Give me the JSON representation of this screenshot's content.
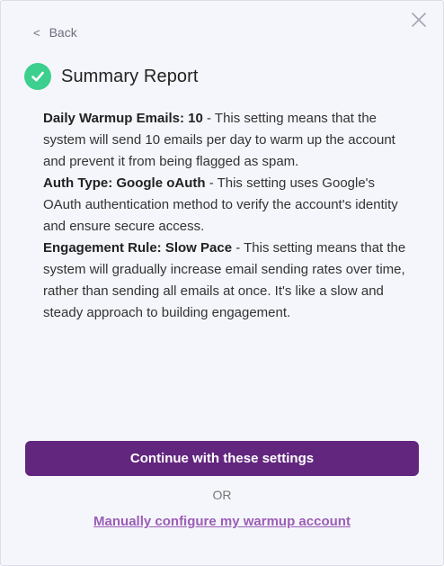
{
  "nav": {
    "back_label": "Back",
    "back_chevron": "<",
    "close_icon": "close-icon"
  },
  "header": {
    "title": "Summary Report",
    "status_icon": "check-circle-icon",
    "status_color": "#3ccf8e"
  },
  "summary": {
    "items": [
      {
        "label": "Daily Warmup Emails: 10",
        "description": " - This setting means that the system will send 10 emails per day to warm up the account and prevent it from being flagged as spam."
      },
      {
        "label": "Auth Type: Google oAuth",
        "description": " - This setting uses Google's OAuth authentication method to verify the account's identity and ensure secure access."
      },
      {
        "label": "Engagement Rule: Slow Pace",
        "description": " - This setting means that the system will gradually increase email sending rates over time, rather than sending all emails at once. It's like a slow and steady approach to building engagement."
      }
    ]
  },
  "actions": {
    "continue_label": "Continue with these settings",
    "continue_color": "#62267e",
    "or_label": "OR",
    "manual_label": "Manually configure my warmup account",
    "manual_color": "#9b5db5"
  }
}
